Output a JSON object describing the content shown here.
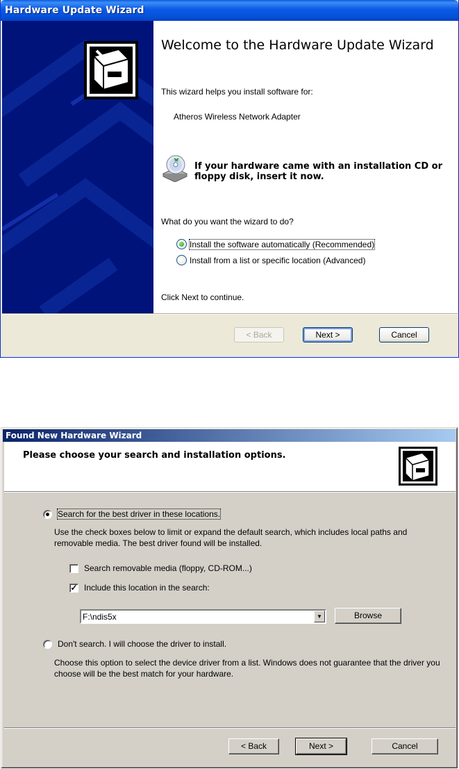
{
  "wizard1": {
    "title": "Hardware Update Wizard",
    "heading": "Welcome to the Hardware Update Wizard",
    "intro": "This wizard helps you install software for:",
    "device": "Atheros Wireless Network Adapter",
    "cd_prompt": "If your hardware came with an installation CD or floppy disk, insert it now.",
    "question": "What do you want the wizard to do?",
    "options": [
      {
        "label": "Install the software automatically (Recommended)",
        "selected": true
      },
      {
        "label": "Install from a list or specific location (Advanced)",
        "selected": false
      }
    ],
    "continue_text": "Click Next to continue.",
    "buttons": {
      "back": "< Back",
      "next": "Next >",
      "cancel": "Cancel"
    }
  },
  "wizard2": {
    "title": "Found New Hardware Wizard",
    "header": "Please choose your search and installation options.",
    "option_search": {
      "label": "Search for the best driver in these locations.",
      "selected": true,
      "description": "Use the check boxes below to limit or expand the default search, which includes local paths and removable media. The best driver found will be installed."
    },
    "check_removable": {
      "label": "Search removable media (floppy, CD-ROM...)",
      "checked": false
    },
    "check_location": {
      "label": "Include this location in the search:",
      "checked": true
    },
    "location_value": "F:\\ndis5x",
    "browse_label": "Browse",
    "option_manual": {
      "label": "Don't search. I will choose the driver to install.",
      "selected": false,
      "description": "Choose this option to select the device driver from a list.  Windows does not guarantee that the driver you choose will be the best match for your hardware."
    },
    "buttons": {
      "back": "< Back",
      "next": "Next >",
      "cancel": "Cancel"
    }
  }
}
